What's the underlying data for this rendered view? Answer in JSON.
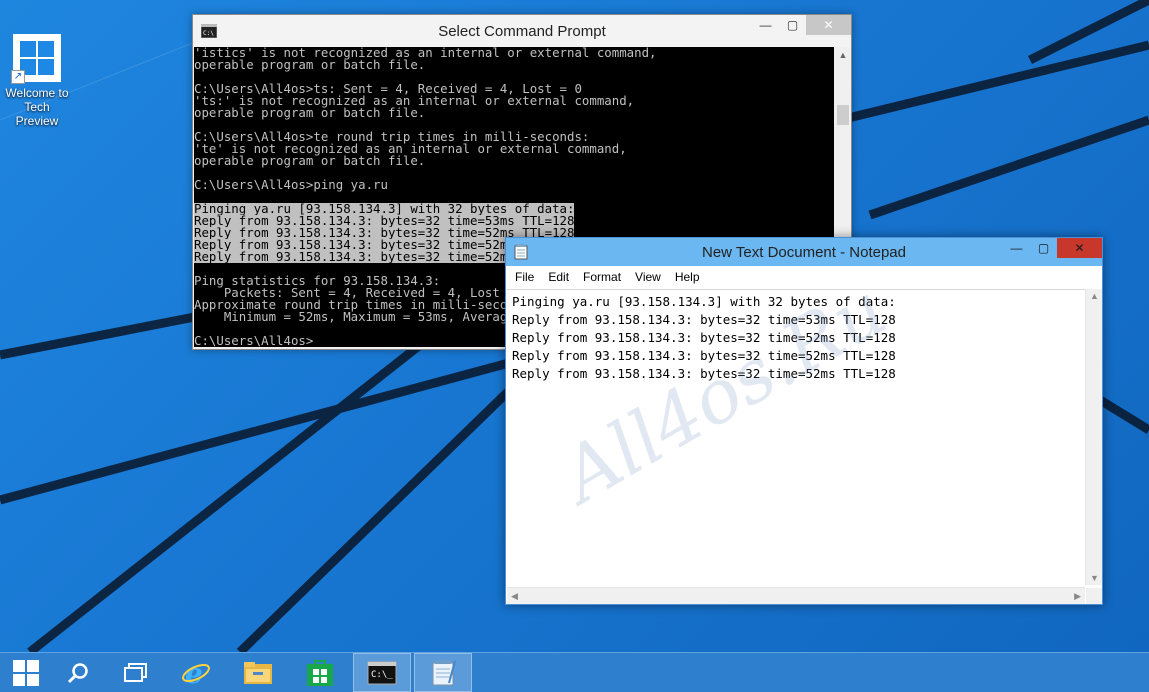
{
  "desktop": {
    "icon_label_line1": "Welcome to",
    "icon_label_line2": "Tech Preview",
    "watermark": "All4os.Ru"
  },
  "cmd": {
    "title": "Select Command Prompt",
    "lines": [
      "'istics' is not recognized as an internal or external command,",
      "operable program or batch file.",
      "",
      "C:\\Users\\All4os>ts: Sent = 4, Received = 4, Lost = 0",
      "'ts:' is not recognized as an internal or external command,",
      "operable program or batch file.",
      "",
      "C:\\Users\\All4os>te round trip times in milli-seconds:",
      "'te' is not recognized as an internal or external command,",
      "operable program or batch file.",
      "",
      "C:\\Users\\All4os>ping ya.ru",
      "",
      "Pinging ya.ru [93.158.134.3] with 32 bytes of data:",
      "Reply from 93.158.134.3: bytes=32 time=53ms TTL=128",
      "Reply from 93.158.134.3: bytes=32 time=52ms TTL=128",
      "Reply from 93.158.134.3: bytes=32 time=52ms TTL=128",
      "Reply from 93.158.134.3: bytes=32 time=52ms TTL=128",
      "",
      "Ping statistics for 93.158.134.3:",
      "    Packets: Sent = 4, Received = 4, Lost = 0 (0% loss),",
      "Approximate round trip times in milli-seconds:",
      "    Minimum = 52ms, Maximum = 53ms, Average = 52ms",
      "",
      "C:\\Users\\All4os>"
    ],
    "selected_line_indices": [
      13,
      14,
      15,
      16,
      17
    ]
  },
  "notepad": {
    "title": "New Text Document - Notepad",
    "menu": {
      "file": "File",
      "edit": "Edit",
      "format": "Format",
      "view": "View",
      "help": "Help"
    },
    "text": "Pinging ya.ru [93.158.134.3] with 32 bytes of data:\nReply from 93.158.134.3: bytes=32 time=53ms TTL=128\nReply from 93.158.134.3: bytes=32 time=52ms TTL=128\nReply from 93.158.134.3: bytes=32 time=52ms TTL=128\nReply from 93.158.134.3: bytes=32 time=52ms TTL=128"
  },
  "window_controls": {
    "minimize": "—",
    "maximize": "▢",
    "close": "✕"
  },
  "taskbar": {
    "items": [
      "start-icon",
      "search-icon",
      "task-view-icon",
      "internet-explorer-icon",
      "file-explorer-icon",
      "store-icon",
      "command-prompt-icon",
      "notepad-icon"
    ],
    "open_items": [
      "command-prompt-icon",
      "notepad-icon"
    ]
  },
  "colors": {
    "desktop_blue": "#1877d2",
    "taskbar": "#2f7fcf",
    "notepad_titlebar_active": "#6ab7f1",
    "close_active": "#c7372c",
    "console_fg": "#c0c0c0"
  }
}
